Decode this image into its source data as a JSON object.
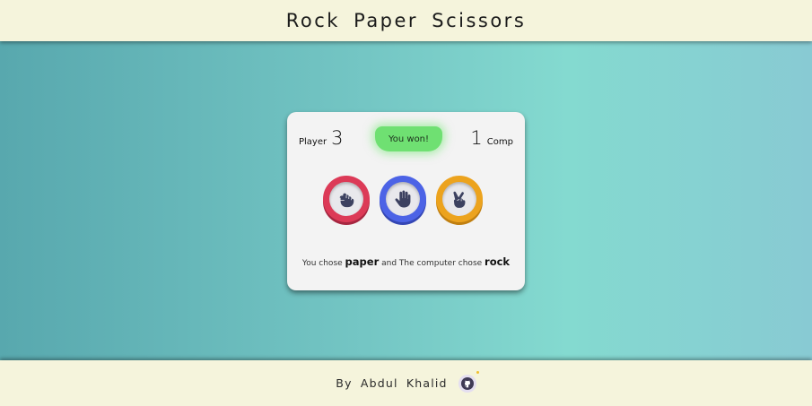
{
  "header": {
    "title": "Rock Paper Scissors"
  },
  "scoreboard": {
    "player_label": "Player",
    "player_score": "3",
    "comp_label": "Comp",
    "comp_score": "1",
    "result": "You won!"
  },
  "choices": [
    {
      "name": "rock",
      "icon": "fist-icon",
      "color": "#dc3a57"
    },
    {
      "name": "paper",
      "icon": "open-hand-icon",
      "color": "#4c63e6"
    },
    {
      "name": "scissors",
      "icon": "peace-hand-icon",
      "color": "#eca31e"
    }
  ],
  "message": {
    "prefix": "You chose",
    "player_choice": "paper",
    "middle": "and The computer chose",
    "computer_choice": "rock"
  },
  "footer": {
    "author": "By Abdul Khalid",
    "github_icon": "github-icon"
  },
  "colors": {
    "bar_background": "#f5f4dc",
    "card_background": "#f3f3f3",
    "win_badge": "#6fe072"
  }
}
